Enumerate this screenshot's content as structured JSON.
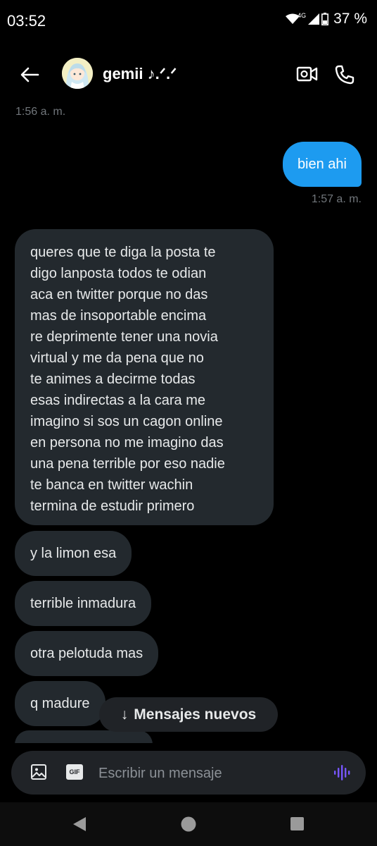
{
  "status_bar": {
    "time": "03:52",
    "network": "4G",
    "battery": "37 %"
  },
  "header": {
    "contact_name": "gemii ♪.ᐟ.ᐟ",
    "avatar_icon": "anime-avatar",
    "back_icon": "arrow-left",
    "video_icon": "video-camera",
    "call_icon": "phone"
  },
  "messages": [
    {
      "type": "timestamp",
      "text": "1:56 a. m."
    },
    {
      "type": "outgoing",
      "text": "bien ahi"
    },
    {
      "type": "timestamp",
      "text": "1:57 a. m."
    },
    {
      "type": "incoming",
      "lines": [
        "queres que te diga la posta te",
        "digo lanposta todos te odian",
        "aca en twitter porque no das",
        "mas de insoportable encima",
        "re deprimente tener una novia",
        "virtual y me da pena que no",
        "te animes a decirme todas",
        "esas indirectas a la cara me",
        "imagino si sos un cagon online",
        "en persona no me imagino das",
        "una pena terrible por eso nadie",
        "te banca en twitter wachin",
        "termina de estudir primero"
      ]
    },
    {
      "type": "incoming",
      "text": "y la limon esa"
    },
    {
      "type": "incoming",
      "text": "terrible inmadura"
    },
    {
      "type": "incoming",
      "text": "otra pelotuda mas"
    },
    {
      "type": "incoming",
      "text": "q madure"
    }
  ],
  "new_messages_button": {
    "arrow": "↓",
    "label": "Mensajes nuevos"
  },
  "composer": {
    "placeholder": "Escribir un mensaje",
    "gif_label": "GIF",
    "image_icon": "image",
    "voice_icon": "voice-wave"
  },
  "colors": {
    "accent": "#1d9bf0",
    "bubble_incoming": "#23292e",
    "voice": "#7856ff"
  }
}
